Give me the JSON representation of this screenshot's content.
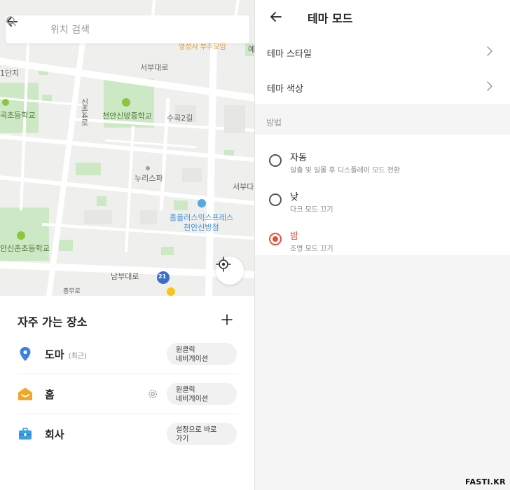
{
  "map": {
    "search_placeholder": "위치 검색",
    "labels": {
      "danji": "1단지",
      "seobudaero_top": "서부대로",
      "elementary_1": "곡초등학교",
      "middle_school": "천안신방중학교",
      "sinchon4ro": "신촌4로",
      "sugok2gil": "수곡2길",
      "nuri_spa": "누리스파",
      "seobuda_right": "서부다",
      "homeplus_line1": "홈플러스익스프레스",
      "homeplus_line2": "천안신방점",
      "elementary_2": "안신촌초등학교",
      "nambudaero": "남부대로",
      "route_21": "21",
      "chungmuro": "충무로",
      "top_orange": "영성시 부주모임",
      "ye": "예"
    }
  },
  "favorites": {
    "title": "자주 가는 장소",
    "items": [
      {
        "name": "도마",
        "sub": "(최근)",
        "action_line1": "원클릭",
        "action_line2": "네비게이션",
        "icon": "location-pin-icon"
      },
      {
        "name": "홈",
        "sub": "",
        "action_line1": "원클릭",
        "action_line2": "네비게이션",
        "icon": "home-icon"
      },
      {
        "name": "회사",
        "sub": "",
        "action_line1": "설정으로 바로",
        "action_line2": "가기",
        "icon": "briefcase-icon"
      }
    ]
  },
  "theme": {
    "title": "테마 모드",
    "menu": [
      {
        "label": "테마 스타일"
      },
      {
        "label": "테마 색상"
      }
    ],
    "section_label": "방법",
    "options": [
      {
        "title": "자동",
        "desc": "일출 및 일몰 후 디스플레이 모드 전환",
        "selected": false
      },
      {
        "title": "낮",
        "desc": "다크 모드 끄기",
        "selected": false
      },
      {
        "title": "밤",
        "desc": "조명 모드 끄기",
        "selected": true
      }
    ]
  },
  "watermark": "FASTI.KR",
  "colors": {
    "accent": "#e8503a",
    "pin_blue": "#3b7fe0",
    "home_orange": "#f5a623",
    "work_blue": "#3b9fe0"
  }
}
